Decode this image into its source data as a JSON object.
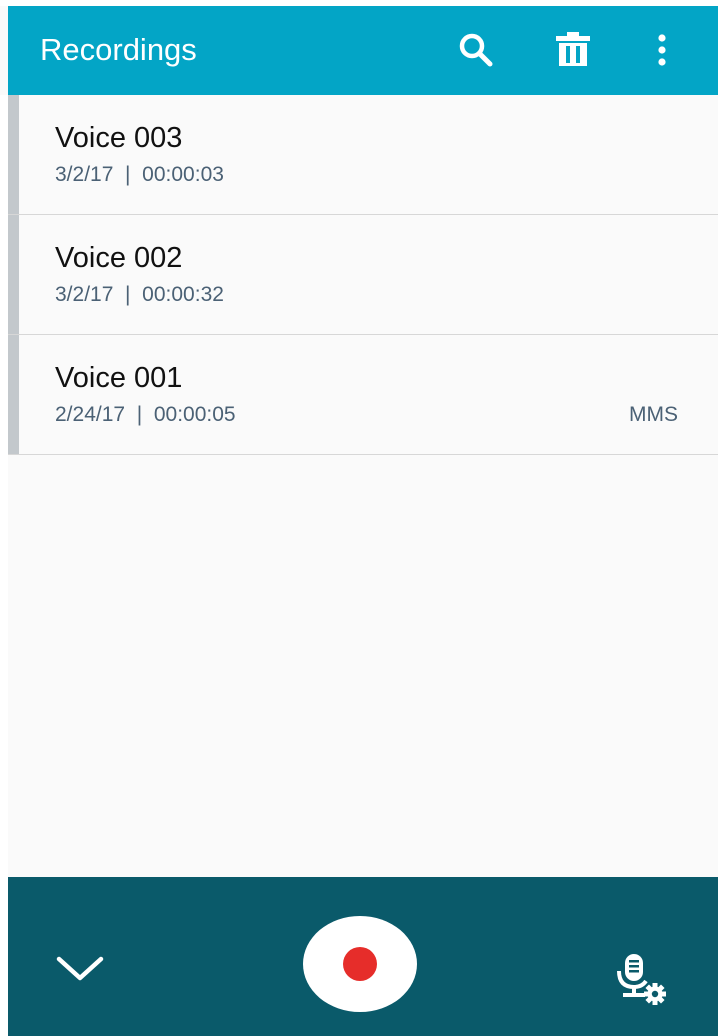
{
  "appbar": {
    "title": "Recordings",
    "actions": [
      {
        "icon": "search-icon"
      },
      {
        "icon": "delete-icon"
      },
      {
        "icon": "more-options-icon"
      }
    ]
  },
  "recordings": [
    {
      "name": "Voice 003",
      "date": "3/2/17",
      "duration": "00:00:03",
      "meta": "3/2/17  |  00:00:03",
      "tag": ""
    },
    {
      "name": "Voice 002",
      "date": "3/2/17",
      "duration": "00:00:32",
      "meta": "3/2/17  |  00:00:32",
      "tag": ""
    },
    {
      "name": "Voice 001",
      "date": "2/24/17",
      "duration": "00:00:05",
      "meta": "2/24/17  |  00:00:05",
      "tag": "MMS"
    }
  ],
  "bottombar": {
    "collapse_icon": "chevron-down-icon",
    "record_icon": "record-icon",
    "settings_icon": "mic-settings-icon"
  },
  "colors": {
    "appbar": "#03a5c6",
    "bottombar": "#0a5a6a",
    "record_dot": "#e62d2a",
    "meta_text": "#4b6175"
  }
}
